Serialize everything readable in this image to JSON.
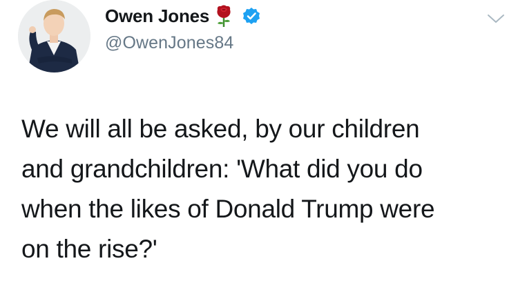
{
  "author": {
    "display_name": "Owen Jones",
    "handle": "@OwenJones84",
    "avatar_icon": "profile-photo",
    "name_emoji_icon": "rose-icon",
    "verified_icon": "verified-badge-icon",
    "verified_color": "#1da1f2"
  },
  "menu": {
    "icon": "chevron-down-icon"
  },
  "tweet": {
    "lines": [
      "We will all be asked, by our children",
      "and grandchildren: 'What did you do",
      "when the likes of Donald Trump were",
      "on the rise?'"
    ]
  }
}
